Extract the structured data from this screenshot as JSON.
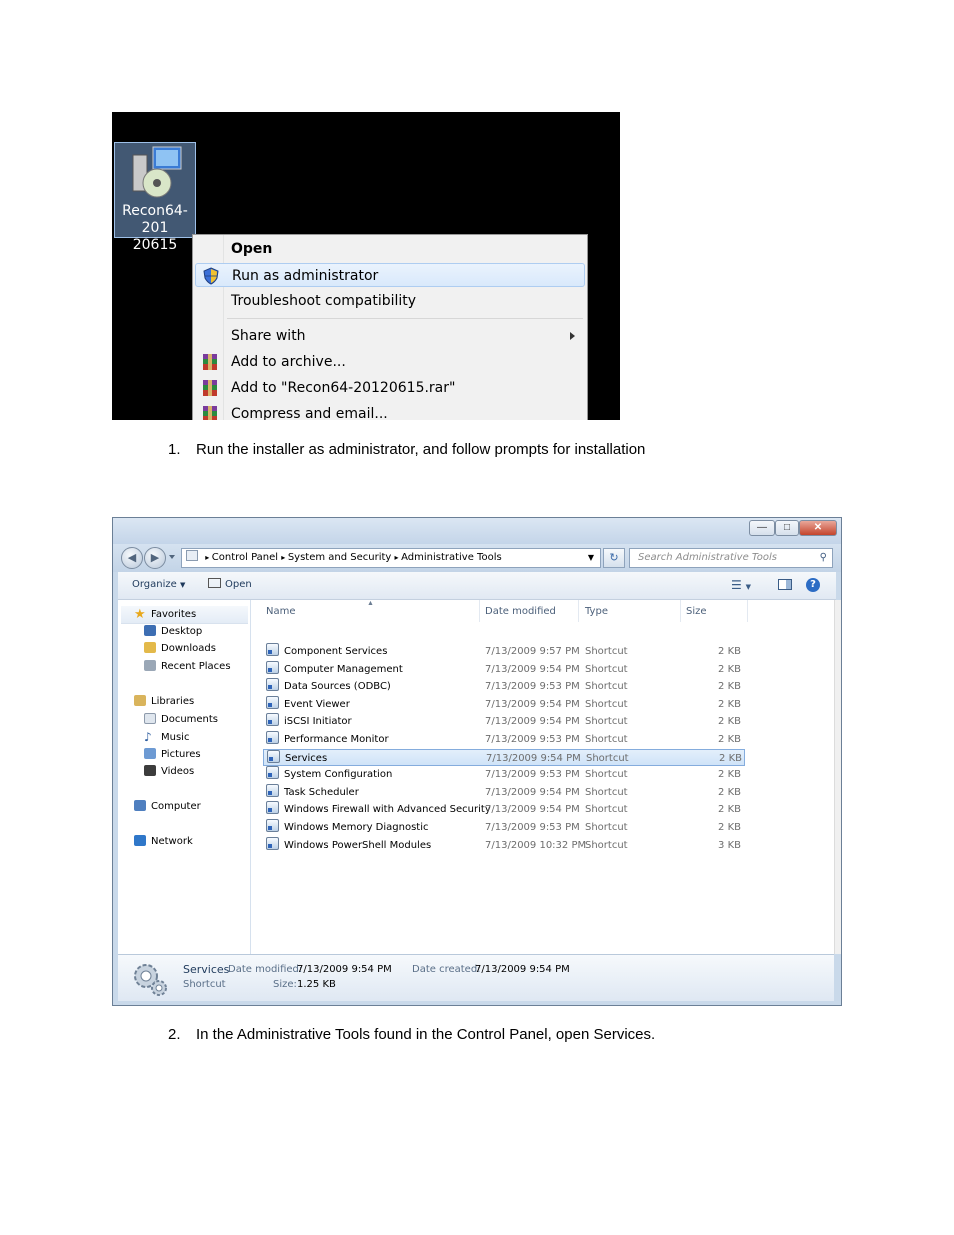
{
  "screenshot1": {
    "desktop_icon_label_line1": "Recon64-201",
    "desktop_icon_label_line2": "20615",
    "menu": [
      {
        "label": "Open"
      },
      {
        "label": "Run as administrator"
      },
      {
        "label": "Troubleshoot compatibility"
      },
      {
        "label": "Share with"
      },
      {
        "label": "Add to archive..."
      },
      {
        "label": "Add to \"Recon64-20120615.rar\""
      },
      {
        "label": "Compress and email..."
      }
    ]
  },
  "caption1": {
    "number": "1.",
    "text": "Run the installer as administrator, and follow prompts for installation"
  },
  "caption2": {
    "number": "2.",
    "text": "In the Administrative Tools found in the Control Panel, open Services."
  },
  "screenshot2": {
    "breadcrumb": [
      "Control Panel",
      "System and Security",
      "Administrative Tools"
    ],
    "search_placeholder": "Search Administrative Tools",
    "toolbar": {
      "organize": "Organize",
      "open": "Open"
    },
    "nav": {
      "favorites": "Favorites",
      "desktop": "Desktop",
      "downloads": "Downloads",
      "recent_places": "Recent Places",
      "libraries": "Libraries",
      "documents": "Documents",
      "music": "Music",
      "pictures": "Pictures",
      "videos": "Videos",
      "computer": "Computer",
      "network": "Network"
    },
    "columns": {
      "name": "Name",
      "date": "Date modified",
      "type": "Type",
      "size": "Size"
    },
    "files": [
      {
        "name": "Component Services",
        "date": "7/13/2009 9:57 PM",
        "type": "Shortcut",
        "size": "2 KB"
      },
      {
        "name": "Computer Management",
        "date": "7/13/2009 9:54 PM",
        "type": "Shortcut",
        "size": "2 KB"
      },
      {
        "name": "Data Sources (ODBC)",
        "date": "7/13/2009 9:53 PM",
        "type": "Shortcut",
        "size": "2 KB"
      },
      {
        "name": "Event Viewer",
        "date": "7/13/2009 9:54 PM",
        "type": "Shortcut",
        "size": "2 KB"
      },
      {
        "name": "iSCSI Initiator",
        "date": "7/13/2009 9:54 PM",
        "type": "Shortcut",
        "size": "2 KB"
      },
      {
        "name": "Performance Monitor",
        "date": "7/13/2009 9:53 PM",
        "type": "Shortcut",
        "size": "2 KB"
      },
      {
        "name": "Services",
        "date": "7/13/2009 9:54 PM",
        "type": "Shortcut",
        "size": "2 KB"
      },
      {
        "name": "System Configuration",
        "date": "7/13/2009 9:53 PM",
        "type": "Shortcut",
        "size": "2 KB"
      },
      {
        "name": "Task Scheduler",
        "date": "7/13/2009 9:54 PM",
        "type": "Shortcut",
        "size": "2 KB"
      },
      {
        "name": "Windows Firewall with Advanced Security",
        "date": "7/13/2009 9:54 PM",
        "type": "Shortcut",
        "size": "2 KB"
      },
      {
        "name": "Windows Memory Diagnostic",
        "date": "7/13/2009 9:53 PM",
        "type": "Shortcut",
        "size": "2 KB"
      },
      {
        "name": "Windows PowerShell Modules",
        "date": "7/13/2009 10:32 PM",
        "type": "Shortcut",
        "size": "3 KB"
      }
    ],
    "details": {
      "name": "Services",
      "type": "Shortcut",
      "modified_label": "Date modified:",
      "modified": "7/13/2009 9:54 PM",
      "created_label": "Date created:",
      "created": "7/13/2009 9:54 PM",
      "size_label": "Size:",
      "size": "1.25 KB"
    }
  }
}
